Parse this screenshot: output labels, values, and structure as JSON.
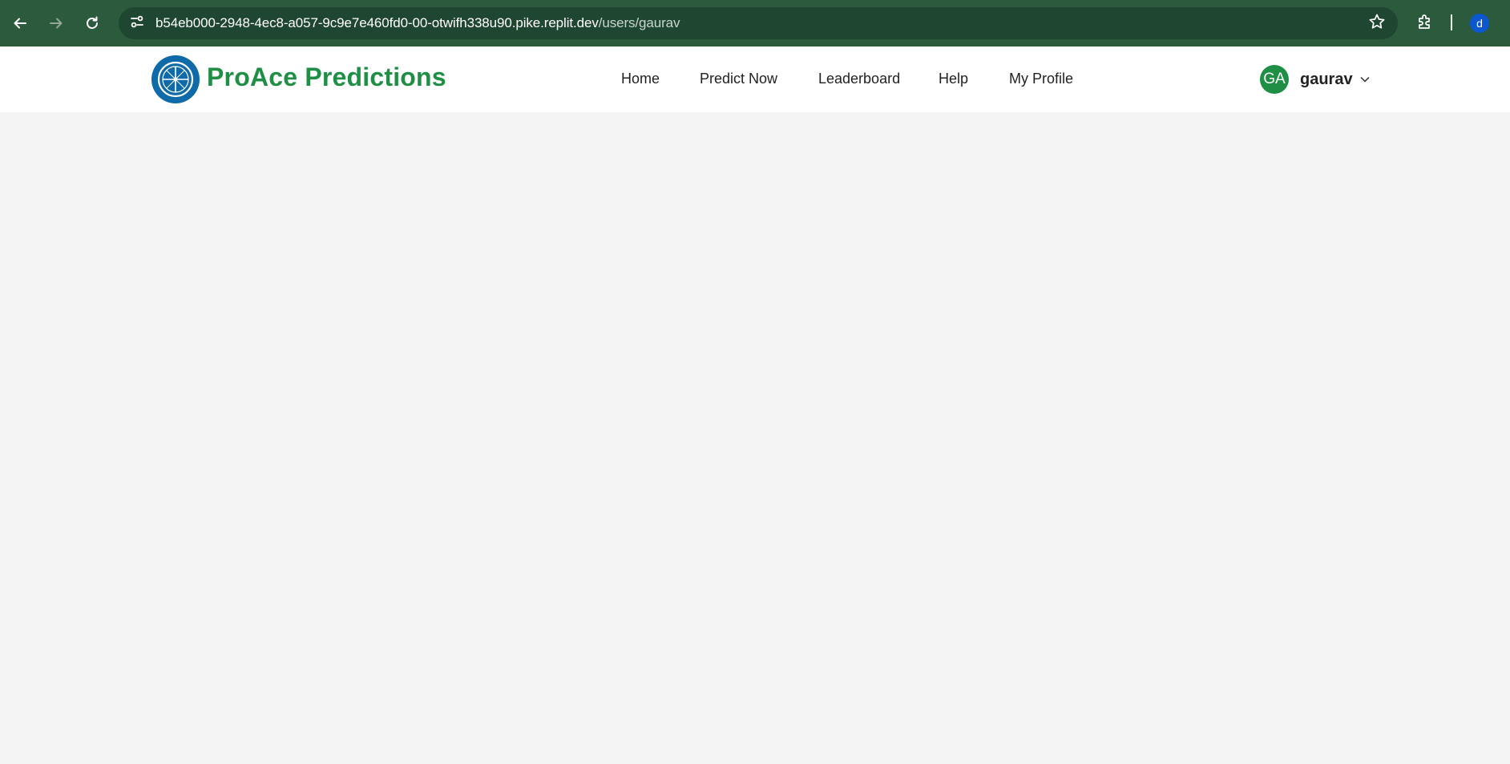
{
  "browser": {
    "url_host": "b54eb000-2948-4ec8-a057-9c9e7e460fd0-00-otwifh338u90.pike.replit.dev",
    "url_path": "/users/gaurav",
    "profile_initial": "d",
    "icons": {
      "back": "arrow-left-icon",
      "forward": "arrow-right-icon",
      "reload": "reload-icon",
      "site_info": "tune-icon",
      "bookmark": "star-icon",
      "extensions": "puzzle-icon"
    }
  },
  "site": {
    "brand": "ProAce Predictions",
    "logo_icon": "compass-logo-icon",
    "nav": [
      {
        "label": "Home"
      },
      {
        "label": "Predict Now"
      },
      {
        "label": "Leaderboard"
      },
      {
        "label": "Help"
      },
      {
        "label": "My Profile"
      }
    ],
    "user": {
      "initials": "GA",
      "name": "gaurav",
      "dropdown_icon": "chevron-down-icon"
    }
  },
  "colors": {
    "chrome_bg": "#2b5a3c",
    "omnibox_bg": "#1f4630",
    "brand_green": "#1e8f45",
    "logo_blue": "#0e6aa8",
    "page_bg": "#f4f4f4",
    "profile_blue": "#0b57d0"
  }
}
